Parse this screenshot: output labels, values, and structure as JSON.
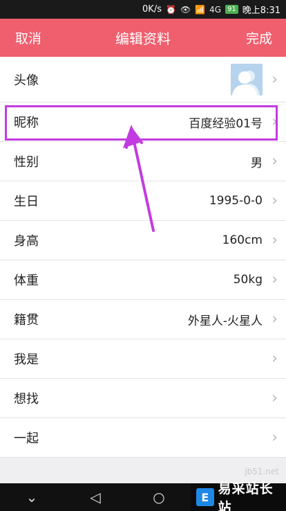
{
  "status_bar": {
    "speed": "0K/s",
    "battery": "91",
    "time": "晚上8:31",
    "network": "4G"
  },
  "nav": {
    "cancel": "取消",
    "title": "编辑资料",
    "done": "完成"
  },
  "rows": [
    {
      "label": "头像",
      "value": ""
    },
    {
      "label": "昵称",
      "value": "百度经验01号"
    },
    {
      "label": "性别",
      "value": "男"
    },
    {
      "label": "生日",
      "value": "1995-0-0"
    },
    {
      "label": "身高",
      "value": "160cm"
    },
    {
      "label": "体重",
      "value": "50kg"
    },
    {
      "label": "籍贯",
      "value": "外星人-火星人"
    },
    {
      "label": "我是",
      "value": ""
    },
    {
      "label": "想找",
      "value": ""
    },
    {
      "label": "一起",
      "value": ""
    }
  ],
  "chevron": "›",
  "brand": {
    "logo": "E",
    "name": "易采站长站",
    "watermark": "jb51.net"
  },
  "colors": {
    "nav_bg": "#ef5f6e",
    "highlight": "#c23be0",
    "avatar_bg": "#b5d3ec"
  }
}
